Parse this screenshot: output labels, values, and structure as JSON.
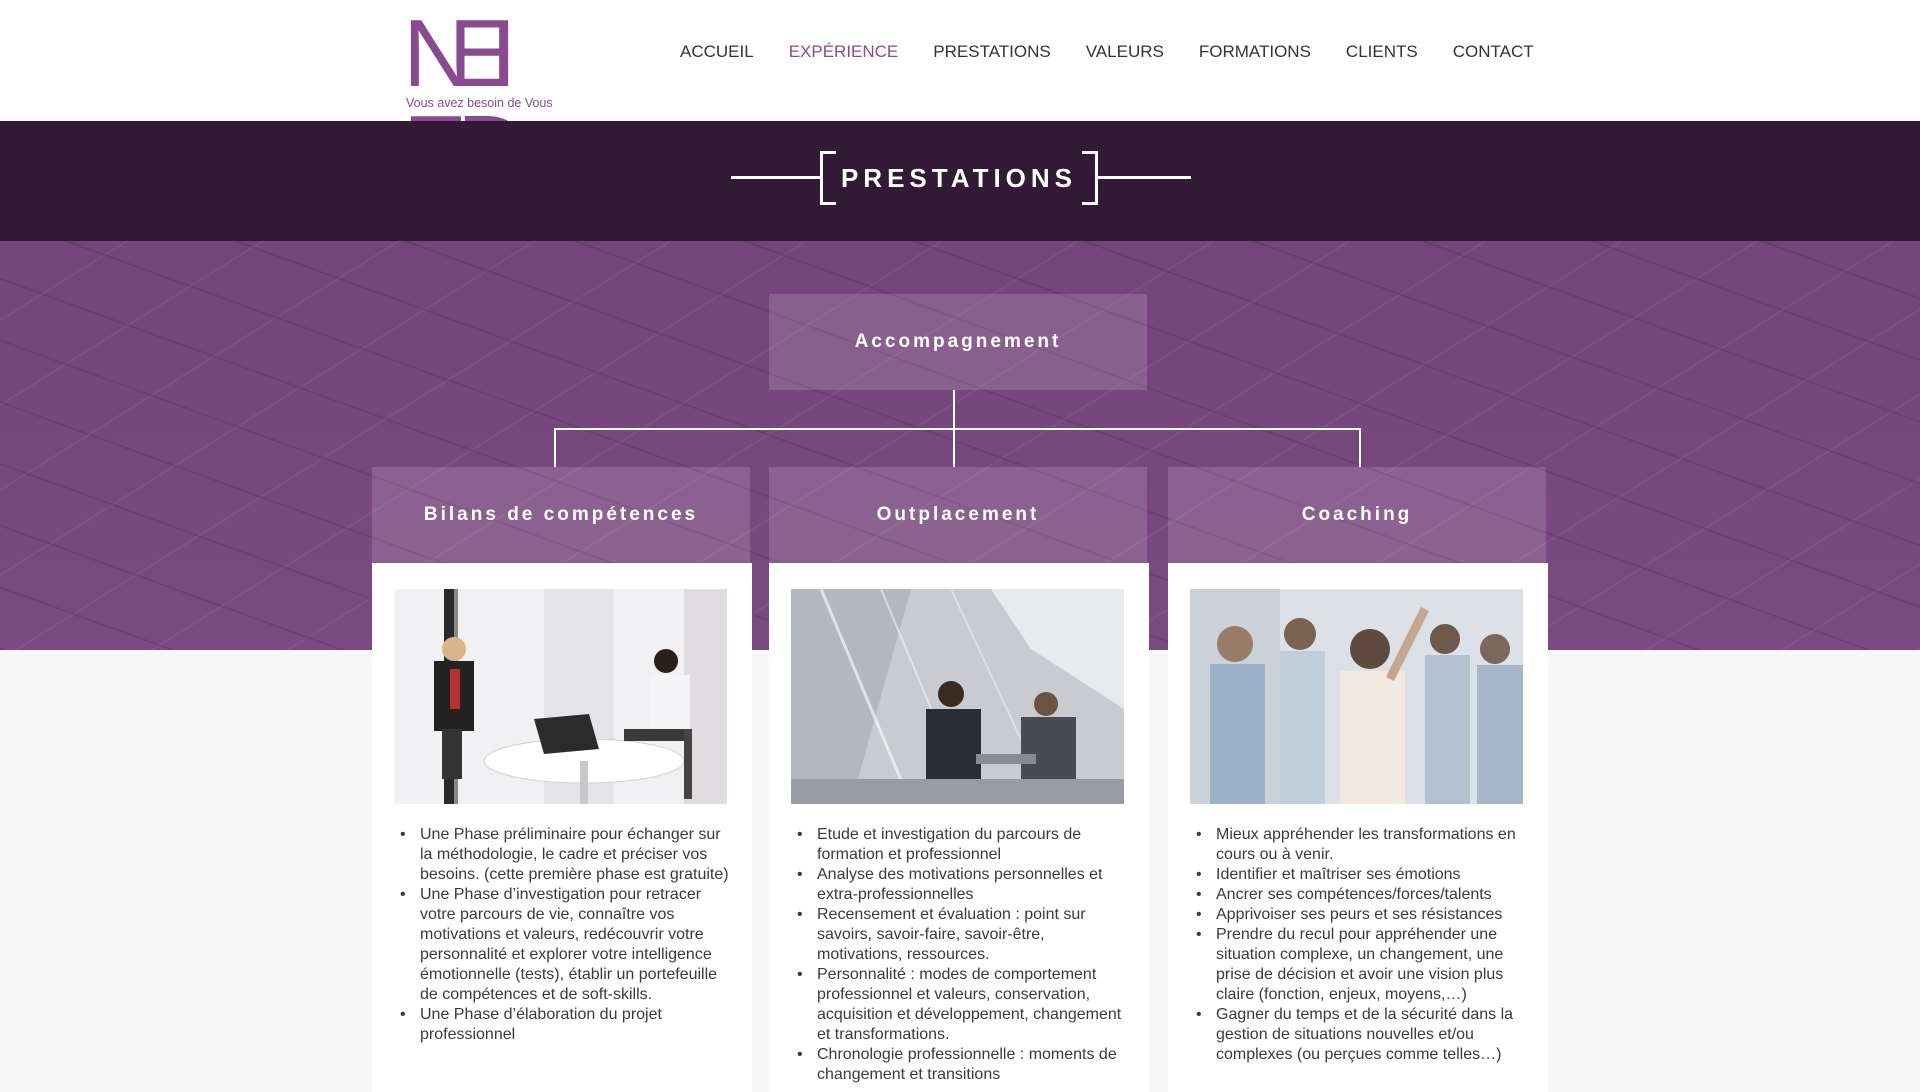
{
  "header": {
    "logo_text": "NEED",
    "tagline": "Vous avez besoin de Vous",
    "nav": [
      {
        "label": "ACCUEIL",
        "active": false
      },
      {
        "label": "EXPÉRIENCE",
        "active": true
      },
      {
        "label": "PRESTATIONS",
        "active": false
      },
      {
        "label": "VALEURS",
        "active": false
      },
      {
        "label": "FORMATIONS",
        "active": false
      },
      {
        "label": "CLIENTS",
        "active": false
      },
      {
        "label": "CONTACT",
        "active": false
      }
    ]
  },
  "section": {
    "title": "PRESTATIONS"
  },
  "chart": {
    "root": "Accompagnement",
    "columns": [
      {
        "title": "Bilans de compétences",
        "items": [
          "Une Phase préliminaire pour échanger sur la méthodologie, le cadre et préciser vos besoins. (cette première phase est gratuite)",
          "Une Phase d’investigation pour retracer votre parcours de vie, connaître vos motivations et valeurs, redécouvrir votre personnalité  et explorer votre intelligence émotionnelle (tests),  établir un portefeuille de compétences et de soft-skills.",
          "Une Phase d’élaboration du projet professionnel"
        ]
      },
      {
        "title": "Outplacement",
        "items": [
          "Etude et investigation du parcours de formation et professionnel",
          "Analyse des motivations personnelles et extra-professionnelles",
          "Recensement et évaluation : point sur savoirs, savoir-faire, savoir-être, motivations, ressources.",
          "Personnalité : modes de comportement professionnel et valeurs, conservation, acquisition et développement, changement et transformations.",
          "Chronologie professionnelle : moments de changement et transitions"
        ]
      },
      {
        "title": "Coaching",
        "items": [
          "Mieux appréhender les transformations en cours ou à venir.",
          "Identifier et maîtriser ses émotions",
          "Ancrer ses compétences/forces/talents",
          "Apprivoiser ses peurs et ses résistances",
          "Prendre du recul pour appréhender une situation complexe, un changement, une prise de décision et avoir une vision plus claire (fonction, enjeux, moyens,…)",
          "Gagner du temps et de la sécurité dans la gestion de situations nouvelles et/ou complexes (ou perçues comme telles…)"
        ]
      }
    ]
  },
  "colors": {
    "accent": "#8a4a8f",
    "band": "#321a36",
    "hero": "#7a4a80"
  }
}
